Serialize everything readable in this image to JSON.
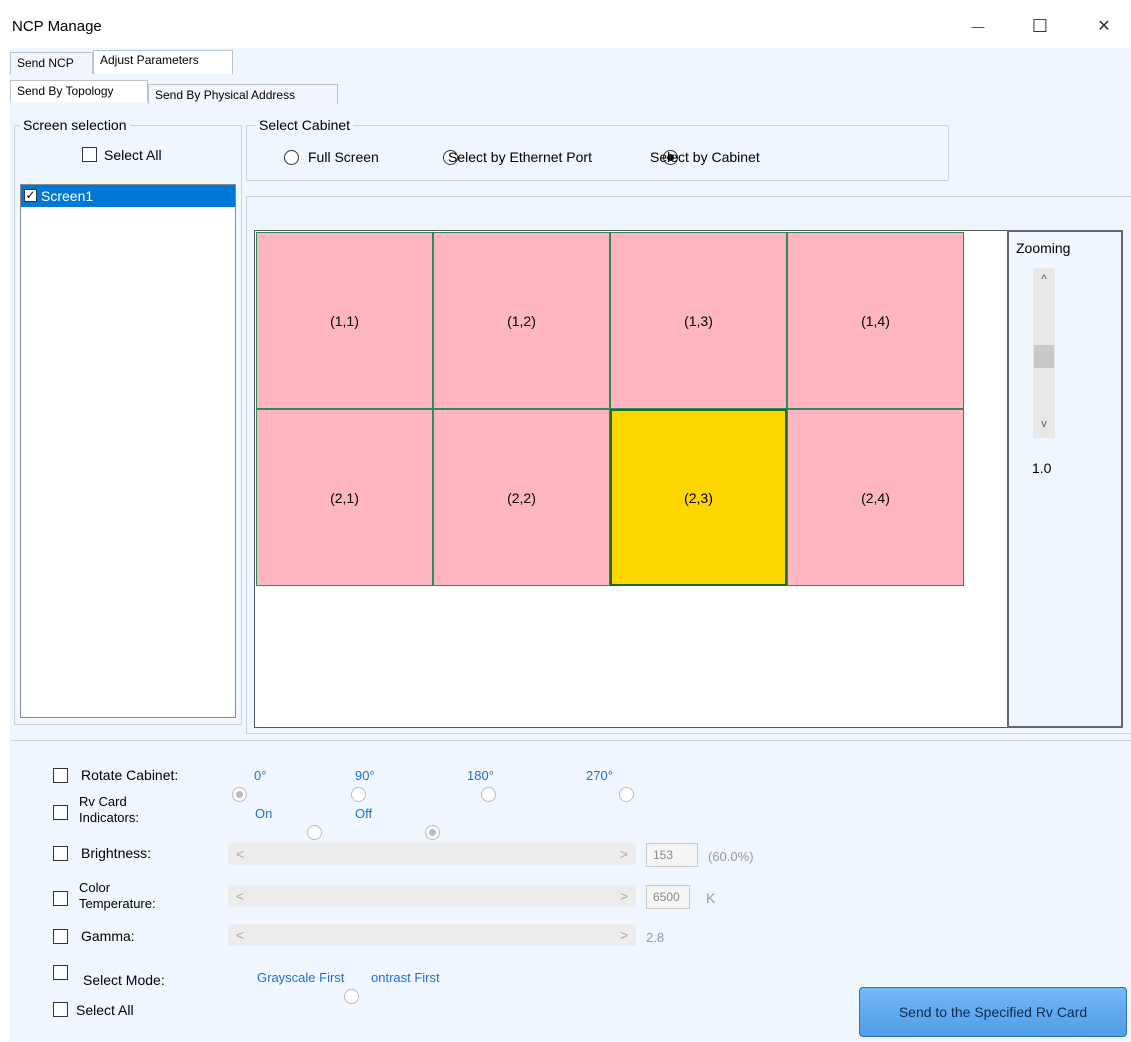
{
  "window": {
    "title": "NCP Manage",
    "min_icon": "—",
    "max_icon": "☐",
    "close_icon": "✕"
  },
  "top_tabs": [
    {
      "label": "Send NCP"
    },
    {
      "label": "Adjust Parameters"
    }
  ],
  "sub_tabs": [
    {
      "label": "Send By Topology"
    },
    {
      "label": "Send By Physical Address"
    }
  ],
  "screen_selection": {
    "legend": "Screen selection",
    "select_all": "Select All",
    "items": [
      {
        "label": "Screen1",
        "checked": true
      }
    ]
  },
  "select_cabinet": {
    "legend": "Select Cabinet",
    "options": [
      {
        "label": "Full Screen",
        "selected": false
      },
      {
        "label": "Select by Ethernet Port",
        "selected": false
      },
      {
        "label": "Select by Cabinet",
        "selected": true
      }
    ]
  },
  "grid": {
    "cells": [
      {
        "label": "(1,1)",
        "selected": false
      },
      {
        "label": "(1,2)",
        "selected": false
      },
      {
        "label": "(1,3)",
        "selected": false
      },
      {
        "label": "(1,4)",
        "selected": false
      },
      {
        "label": "(2,1)",
        "selected": false
      },
      {
        "label": "(2,2)",
        "selected": false
      },
      {
        "label": "(2,3)",
        "selected": true
      },
      {
        "label": "(2,4)",
        "selected": false
      }
    ],
    "colors": {
      "cell": "#ffb6c1",
      "selected": "#ffd700",
      "border": "#2e8b57"
    }
  },
  "zoom": {
    "label": "Zooming",
    "value": "1.0",
    "up_icon": "^",
    "down_icon": "v"
  },
  "params": {
    "rotate": {
      "label": "Rotate Cabinet:",
      "options": [
        "0°",
        "90°",
        "180°",
        "270°"
      ],
      "selected_index": 0
    },
    "indicators": {
      "label_line1": "Rv Card",
      "label_line2": "Indicators:",
      "options": [
        "On",
        "Off"
      ],
      "selected_index": 1
    },
    "brightness": {
      "label": "Brightness:",
      "value": "153",
      "percent": "(60.0%)"
    },
    "color_temp": {
      "label_line1": "Color",
      "label_line2": "Temperature:",
      "value": "6500",
      "unit": "K"
    },
    "gamma": {
      "label": "Gamma:",
      "value": "2.8"
    },
    "select_mode": {
      "label": "Select Mode:",
      "option1": "Grayscale First",
      "option2": "ontrast First"
    },
    "select_all": "Select All",
    "arrow_left": "<",
    "arrow_right": ">"
  },
  "send_button": {
    "label": "Send to the Specified Rv Card",
    "color": "#5ba9f0"
  }
}
